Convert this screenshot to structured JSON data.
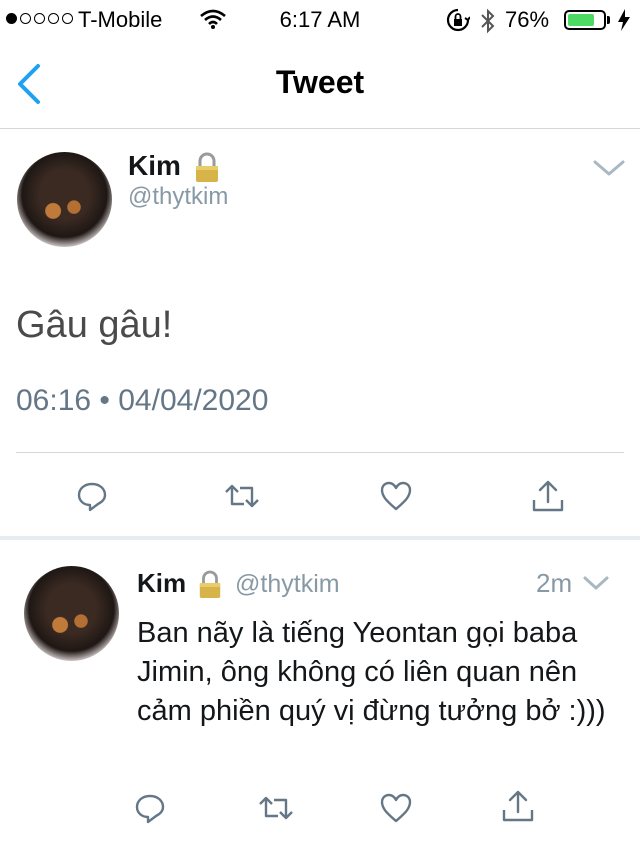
{
  "status_bar": {
    "carrier": "T-Mobile",
    "time": "6:17 AM",
    "battery_percent": "76%",
    "battery_level": 0.76,
    "signal_bars_filled": 1,
    "signal_bars_total": 5
  },
  "nav": {
    "back_icon": "chevron-left-icon",
    "title": "Tweet"
  },
  "tweet": {
    "name": "Kim",
    "handle": "@thytkim",
    "protected_icon": "lock-icon",
    "text": "Gâu gâu!",
    "timestamp": "06:16 • 04/04/2020",
    "actions": [
      "reply-icon",
      "retweet-icon",
      "like-icon",
      "share-icon"
    ]
  },
  "reply": {
    "name": "Kim",
    "handle": "@thytkim",
    "time": "2m",
    "text": "Ban nãy là tiếng Yeontan gọi baba Jimin, ông không có liên quan nên cảm phiền quý vị đừng tưởng bở :)))",
    "actions": [
      "reply-icon",
      "retweet-icon",
      "like-icon",
      "share-icon"
    ]
  },
  "colors": {
    "accent": "#1da1f2",
    "secondary_text": "#8899a6",
    "icon_gray": "#657786",
    "battery_green": "#4cd964"
  }
}
